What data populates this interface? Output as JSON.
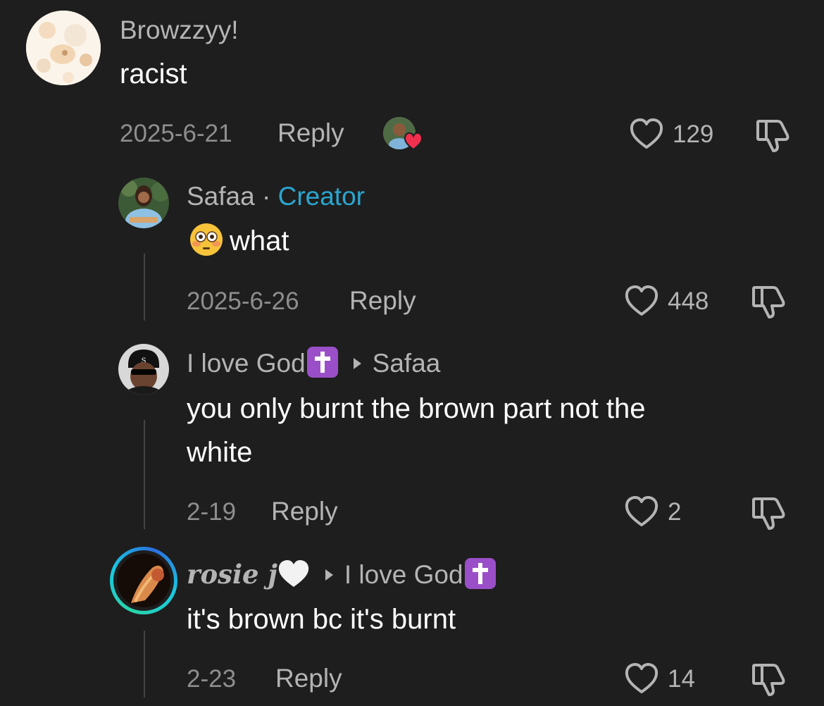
{
  "comments": [
    {
      "username": "Browzzyy!",
      "text": "racist",
      "date": "2025-6-21",
      "reply_label": "Reply",
      "likes": "129"
    },
    {
      "username": "Safaa",
      "separator": "·",
      "badge": "Creator",
      "text": "what",
      "date": "2025-6-26",
      "reply_label": "Reply",
      "likes": "448"
    },
    {
      "username": "I love God",
      "reply_to": "Safaa",
      "text_line1": "you only burnt the brown part not the",
      "text_line2": "white",
      "date": "2-19",
      "reply_label": "Reply",
      "likes": "2"
    },
    {
      "username": "rosie j",
      "reply_to": "I love God",
      "text": "it's brown bc it's burnt",
      "date": "2-23",
      "reply_label": "Reply",
      "likes": "14"
    }
  ],
  "colors": {
    "background": "#1e1e1e",
    "creator_badge": "#2aa6cf",
    "cross_badge": "#9a4fc8",
    "liked_heart": "#f0304f"
  },
  "icons": {
    "like": "heart-outline-icon",
    "dislike": "thumbs-down-icon",
    "creator_liked": "creator-liked-heart-icon",
    "cross": "latin-cross-icon",
    "flushed": "flushed-face-emoji",
    "white_heart": "white-heart-emoji"
  }
}
